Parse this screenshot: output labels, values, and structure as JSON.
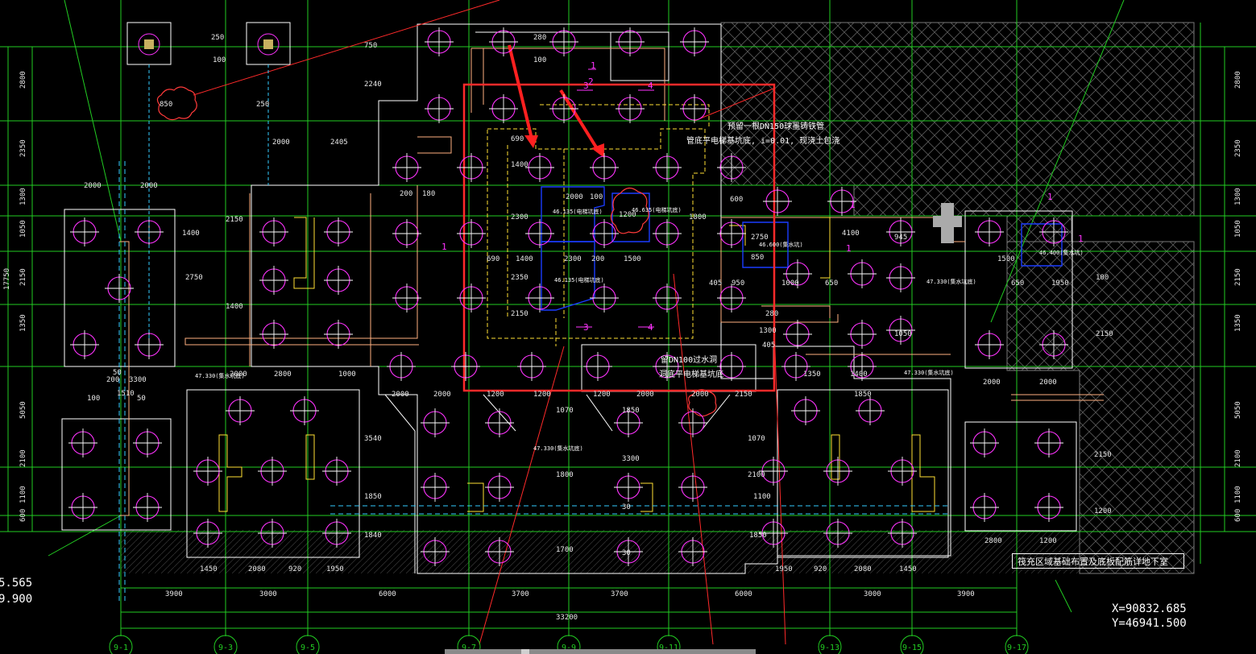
{
  "viewport": {
    "title_block": "筏充区域基础布置及底板配筋详地下室",
    "coord_x": "X=90832.685",
    "coord_y": "Y=46941.500",
    "left_values": [
      "5.565",
      "9.900"
    ],
    "notes": {
      "pipe_note_1": "预留一根DN150球墨铸铁管",
      "pipe_note_2": "管底平电梯基坑底, i=0.01, 现浇土包浇",
      "drain_note_1": "留DN100过水洞",
      "drain_note_2": "洞底平电梯基坑底"
    },
    "levels": [
      "46.135(电梯坑底)",
      "46.635(电梯坑底)",
      "46.135(电梯坑底)",
      "46.400(集水坑)",
      "46.600(集水坑)",
      "47.330(集水坑底)",
      "47.330(集水坑底)",
      "47.330(集水坑底)",
      "47.330(集水坑底)"
    ],
    "axis_labels": [
      "9-1",
      "9-3",
      "9-5",
      "9-7",
      "9-9",
      "9-11",
      "9-13",
      "9-15",
      "9-17"
    ],
    "section_marks": [
      "1",
      "2",
      "1",
      "3",
      "4",
      "3",
      "4",
      "1",
      "1",
      "1",
      "1"
    ],
    "bottom_dims": [
      "3900",
      "3000",
      "6000",
      "3700",
      "3700",
      "6000",
      "3000",
      "3900"
    ],
    "total_dim": "33200",
    "lower_dims": [
      "1450",
      "2080",
      "920",
      "1950",
      "1950",
      "920",
      "2080",
      "1450"
    ],
    "left_dims": [
      "2800",
      "2350",
      "1300",
      "1050",
      "2150",
      "1350",
      "5050",
      "2100",
      "1100",
      "600",
      "17750"
    ],
    "right_dims": [
      "2800",
      "2350",
      "1300",
      "1050",
      "2150",
      "1350",
      "5050",
      "2100",
      "1100",
      "600"
    ],
    "misc_dims": [
      "250",
      "100",
      "750",
      "280",
      "100",
      "2240",
      "850",
      "250",
      "2000",
      "2405",
      "690",
      "1400",
      "2000",
      "2000",
      "2000",
      "100",
      "1400",
      "2150",
      "4100",
      "2750",
      "1400",
      "1800",
      "200",
      "180",
      "2300",
      "2350",
      "690",
      "1400",
      "2300",
      "200",
      "1500",
      "2150",
      "600",
      "950",
      "1000",
      "2750",
      "850",
      "650",
      "405",
      "280",
      "1300",
      "405",
      "945",
      "1050",
      "1950",
      "1500",
      "650",
      "100",
      "2150",
      "1350",
      "1400",
      "2000",
      "2000",
      "2000",
      "2800",
      "1000",
      "1200",
      "2000",
      "2000",
      "1200",
      "1200",
      "1200",
      "2000",
      "2000",
      "2150",
      "1850",
      "100",
      "50",
      "50",
      "200",
      "3300",
      "1510",
      "3540",
      "1070",
      "1800",
      "1850",
      "1840",
      "1700",
      "1850",
      "3300",
      "30",
      "30",
      "1070",
      "2100",
      "1100",
      "1850",
      "2150",
      "1200",
      "2800",
      "1200"
    ]
  },
  "ui": {
    "scrollbar": "horizontal-scrollbar"
  },
  "colors": {
    "background": "#000000",
    "grid": "#22cc22",
    "slab": "#ffffff",
    "pile": "#ff33ff",
    "highlight": "#ff2a2a",
    "pit": "#ffe033",
    "pipe": "#ffb080",
    "blue": "#1a3cff",
    "cyan": "#33ccff",
    "hatch": "#6a6a6a"
  }
}
